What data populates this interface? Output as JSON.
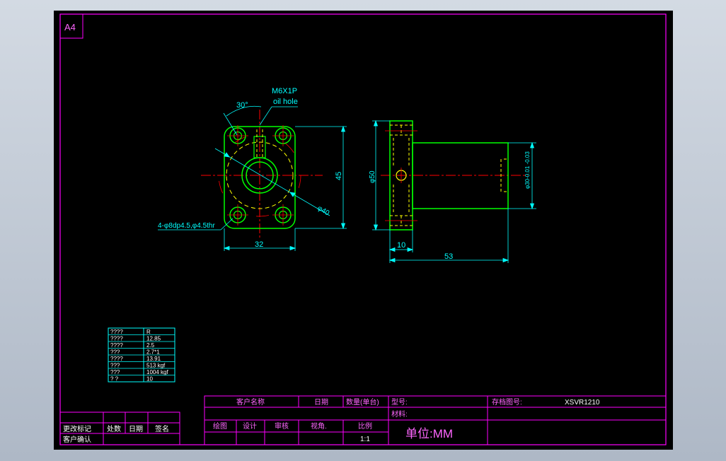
{
  "sheet": {
    "size_label": "A4",
    "colors": {
      "background": "#000000",
      "frame": "#ff00ff",
      "outline": "#00ff00",
      "centerline": "#ff0000",
      "hidden": "#ffff00",
      "dimension": "#00ffff",
      "text": "#ffffff",
      "title_text": "#ff66ff"
    }
  },
  "front_view": {
    "thread_label": "M6X1P",
    "oil_hole_label": "oil hole",
    "angle_label": "30°",
    "height_dim": "45",
    "width_dim": "32",
    "pcd_dim": "φ40",
    "holes_label": "4-φ8dp4.5,φ4.5thr"
  },
  "side_view": {
    "flange_dia_dim": "φ50",
    "body_dia_dim": "φ30-0.01 -0.03",
    "flange_thickness_dim": "10",
    "length_dim": "53"
  },
  "spec_table": {
    "rows": [
      {
        "label": "????",
        "value": "R"
      },
      {
        "label": "????",
        "value": "12.85"
      },
      {
        "label": "????",
        "value": "2.5"
      },
      {
        "label": "???",
        "value": "2.7*1"
      },
      {
        "label": "????",
        "value": "13.91"
      },
      {
        "label": "???",
        "value": "513 kgf"
      },
      {
        "label": "???",
        "value": "1004 kgf"
      },
      {
        "label": "?   ?",
        "value": "10"
      }
    ]
  },
  "revision_block": {
    "change_mark": "更改标记",
    "count": "处数",
    "date": "日期",
    "signature": "签名",
    "customer_confirm": "客户确认"
  },
  "title_block": {
    "customer_name": "客户名称",
    "date": "日期",
    "quantity": "数量(单台)",
    "model": "型号:",
    "drawing_no_label": "存档图号:",
    "drawing_no_value": "XSVR1210",
    "material": "材料:",
    "drawn": "绘图",
    "design": "设计",
    "review": "审核",
    "view_angle": "视角.",
    "scale_label": "比例",
    "scale_value": "1:1",
    "unit": "单位:MM"
  }
}
